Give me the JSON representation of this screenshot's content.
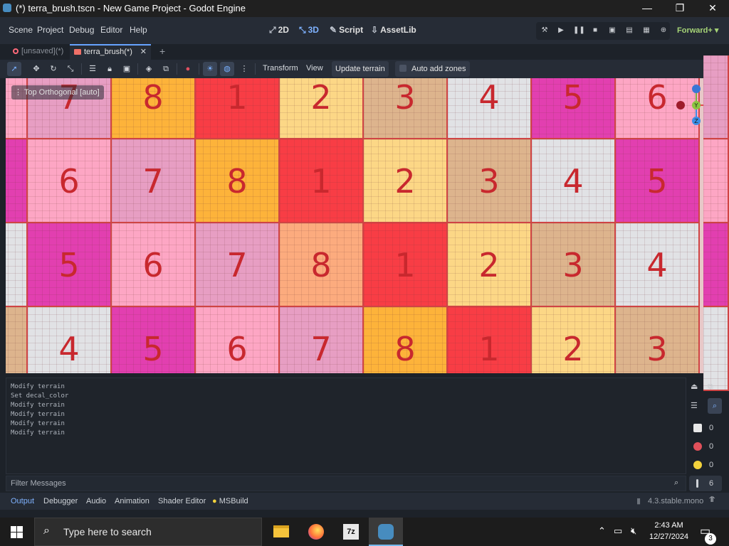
{
  "window": {
    "title": "(*) terra_brush.tscn - New Game Project - Godot Engine",
    "minimize": "—",
    "maximize": "❐",
    "close": "✕"
  },
  "menu": {
    "items": [
      "Scene",
      "Project",
      "Debug",
      "Editor",
      "Help"
    ]
  },
  "modes": [
    {
      "label": "2D",
      "icon": "2d-icon"
    },
    {
      "label": "3D",
      "icon": "3d-icon"
    },
    {
      "label": "Script",
      "icon": "script-icon"
    },
    {
      "label": "AssetLib",
      "icon": "assetlib-icon"
    }
  ],
  "renderer": "Forward+",
  "tabs": [
    {
      "label": "[unsaved](*)"
    },
    {
      "label": "terra_brush(*)"
    }
  ],
  "toolbar": {
    "transform": "Transform",
    "view": "View",
    "update_terrain": "Update terrain",
    "auto_add_zones": "Auto add zones"
  },
  "viewport": {
    "label": "Top Orthogonal [auto]",
    "rows": [
      {
        "numbers": [
          "7",
          "8",
          "1",
          "2",
          "3",
          "4",
          "5",
          "6"
        ],
        "colors": [
          "#e79ec3",
          "#fdb33a",
          "#f83d45",
          "#fcd786",
          "#ddb48d",
          "#e1e2e5",
          "#e23fb0",
          "#fda6c4"
        ]
      },
      {
        "numbers": [
          "6",
          "7",
          "8",
          "1",
          "2",
          "3",
          "4",
          "5"
        ],
        "colors": [
          "#fda6c4",
          "#e79ec3",
          "#fdb33a",
          "#f83d45",
          "#fcd786",
          "#ddb48d",
          "#e1e2e5",
          "#e23fb0"
        ]
      },
      {
        "numbers": [
          "5",
          "6",
          "7",
          "8",
          "1",
          "2",
          "3",
          "4"
        ],
        "colors": [
          "#e23fb0",
          "#fda6c4",
          "#e79ec3",
          "#fcab7e",
          "#f83d45",
          "#fcd786",
          "#ddb48d",
          "#e1e2e5"
        ]
      },
      {
        "numbers": [
          "4",
          "5",
          "6",
          "7",
          "8",
          "1",
          "2",
          "3"
        ],
        "colors": [
          "#e1e2e5",
          "#e23fb0",
          "#fda6c4",
          "#e79ec3",
          "#fdb33a",
          "#f83d45",
          "#fcd786",
          "#ddb48d"
        ]
      }
    ],
    "left_edge_colors": [
      "#fda6c4",
      "#e23fb0",
      "#e1e2e5",
      "#ddb48d"
    ],
    "right_edge_colors": [
      "#e79ec3",
      "#fda6c4",
      "#e23fb0",
      "#e1e2e5"
    ],
    "gizmo": {
      "y": "Y",
      "x": "X",
      "z": "Z"
    }
  },
  "output": {
    "lines": [
      "Modify terrain",
      "Set decal_color",
      "Modify terrain",
      "Modify terrain",
      "Modify terrain",
      "Modify terrain"
    ],
    "filter_placeholder": "Filter Messages",
    "counts": {
      "messages": "0",
      "errors": "0",
      "warnings": "0",
      "info": "6"
    }
  },
  "bottom_tabs": [
    "Output",
    "Debugger",
    "Audio",
    "Animation",
    "Shader Editor",
    "MSBuild"
  ],
  "version": "4.3.stable.mono",
  "taskbar": {
    "search_placeholder": "Type here to search",
    "time": "2:43 AM",
    "date": "12/27/2024",
    "notifications": "3"
  }
}
